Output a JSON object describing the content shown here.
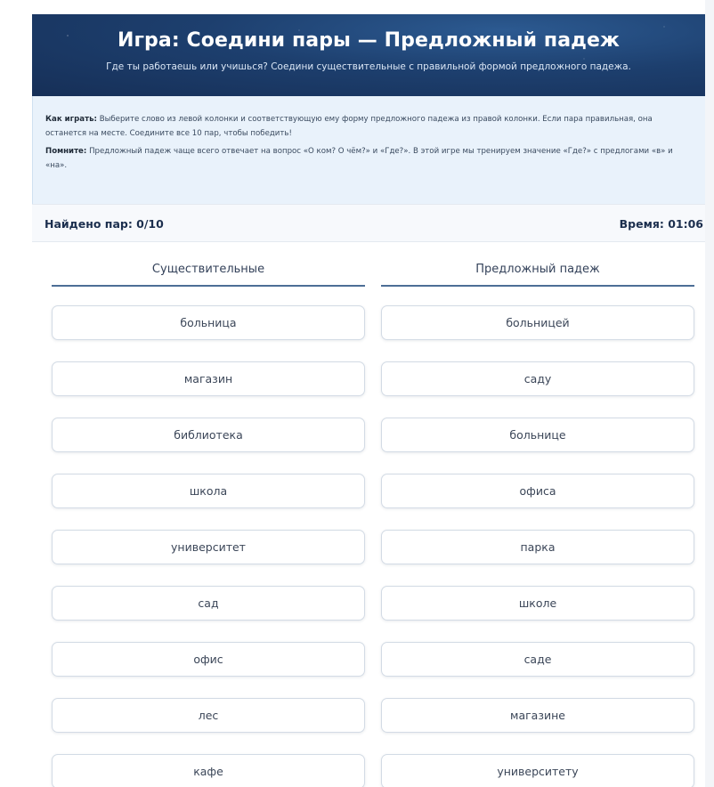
{
  "header": {
    "title": "Игра: Соедини пары — Предложный падеж",
    "subtitle": "Где ты работаешь или учишься? Соедини существительные с правильной формой предложного падежа."
  },
  "instructions": {
    "how_to_label": "Как играть:",
    "how_to_text": "Выберите слово из левой колонки и соответствующую ему форму предложного падежа из правой колонки. Если пара правильная, она останется на месте. Соедините все 10 пар, чтобы победить!",
    "remember_label": "Помните:",
    "remember_text": "Предложный падеж чаще всего отвечает на вопрос «О ком? О чём?» и «Где?». В этой игре мы тренируем значение «Где?» с предлогами «в» и «на»."
  },
  "status": {
    "found_pairs": "Найдено пар: 0/10",
    "timer": "Время: 01:06"
  },
  "columns": {
    "left_header": "Существительные",
    "right_header": "Предложный падеж",
    "left_items": [
      "больница",
      "магазин",
      "библиотека",
      "школа",
      "университет",
      "сад",
      "офис",
      "лес",
      "кафе"
    ],
    "right_items": [
      "больницей",
      "саду",
      "больнице",
      "офиса",
      "парка",
      "школе",
      "саде",
      "магазине",
      "университету"
    ]
  },
  "colors": {
    "header_bg": "#1d3f6e",
    "instructions_bg": "#e9f2fb",
    "column_underline": "#4d6e96"
  }
}
